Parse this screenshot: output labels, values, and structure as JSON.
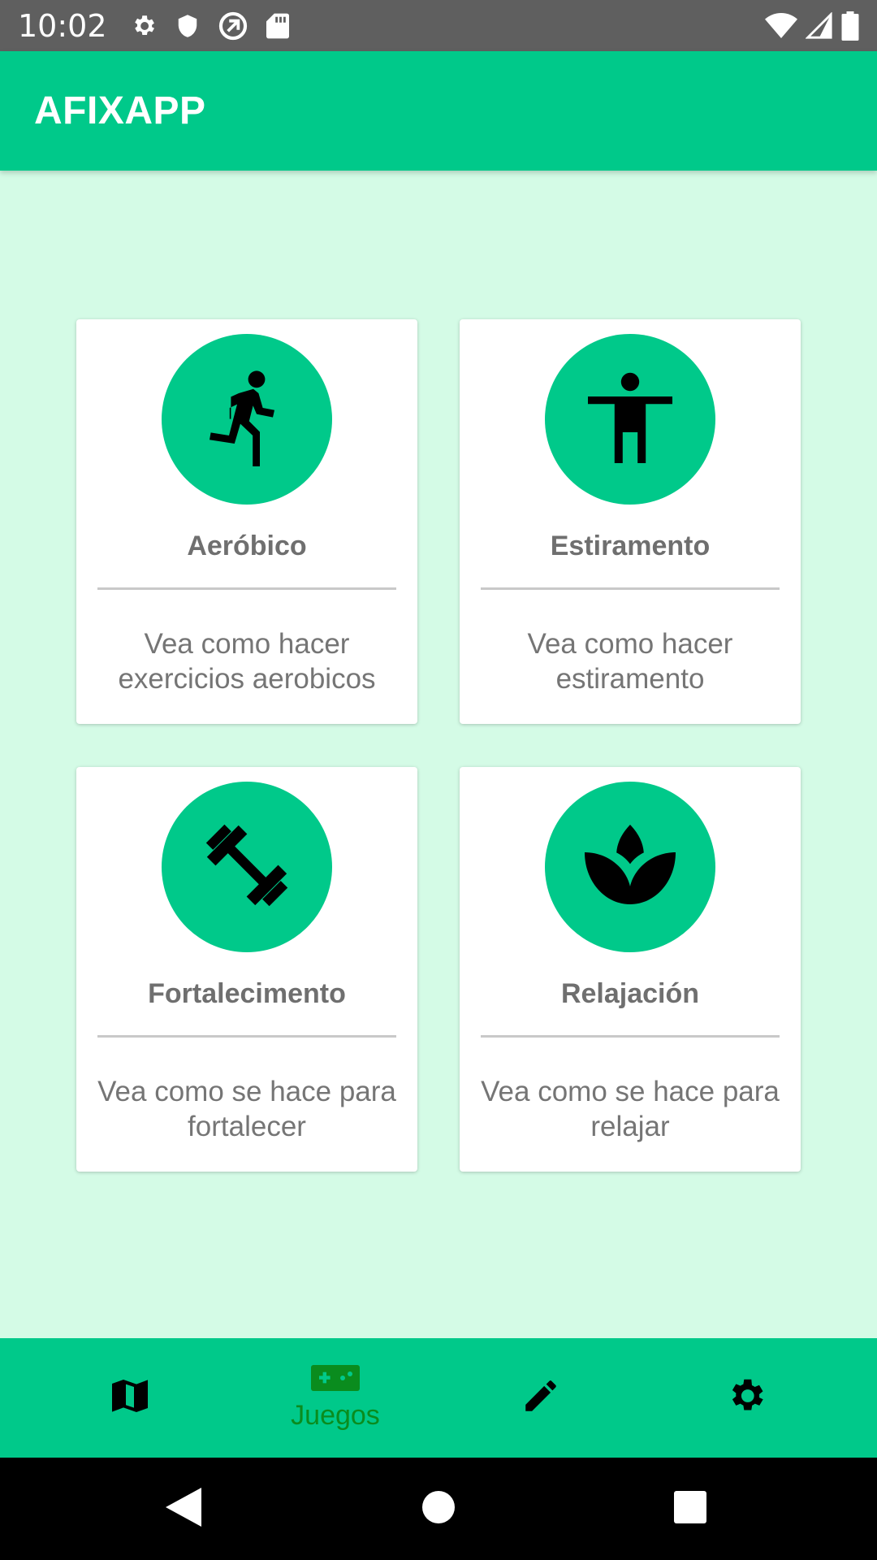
{
  "status_bar": {
    "time": "10:02",
    "icons_left": [
      "settings-icon",
      "shield-icon",
      "no-data-icon",
      "sd-card-icon"
    ],
    "icons_right": [
      "wifi-icon",
      "signal-icon",
      "battery-icon"
    ]
  },
  "app_bar": {
    "title": "AFIXAPP"
  },
  "colors": {
    "primary": "#00c98a",
    "background": "#d4fbe6",
    "active_nav": "#0a8c1e"
  },
  "cards": [
    {
      "icon": "running-icon",
      "title": "Aeróbico",
      "description": "Vea como hacer exercicios aerobicos"
    },
    {
      "icon": "stretching-icon",
      "title": "Estiramento",
      "description": "Vea como hacer estiramento"
    },
    {
      "icon": "dumbbell-icon",
      "title": "Fortalecimento",
      "description": "Vea como se hace para fortalecer"
    },
    {
      "icon": "lotus-icon",
      "title": "Relajación",
      "description": "Vea como se hace para relajar"
    }
  ],
  "bottom_nav": {
    "items": [
      {
        "icon": "map-icon",
        "label": ""
      },
      {
        "icon": "gamepad-icon",
        "label": "Juegos",
        "active": true
      },
      {
        "icon": "pencil-icon",
        "label": ""
      },
      {
        "icon": "gear-icon",
        "label": ""
      }
    ]
  },
  "system_nav": [
    "back-icon",
    "home-icon",
    "recents-icon"
  ]
}
